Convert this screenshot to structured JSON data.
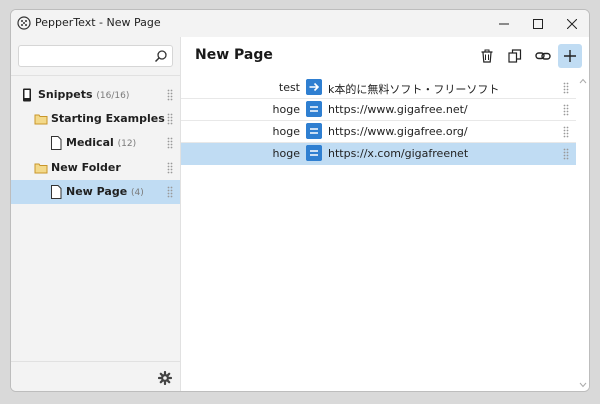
{
  "window": {
    "title": "PepperText - New Page"
  },
  "search": {
    "placeholder": "",
    "value": ""
  },
  "sidebar": {
    "items": [
      {
        "label": "Snippets",
        "count": "(16/16)"
      },
      {
        "label": "Starting Examples",
        "count": ""
      },
      {
        "label": "Medical",
        "count": "(12)"
      },
      {
        "label": "New Folder",
        "count": ""
      },
      {
        "label": "New Page",
        "count": "(4)"
      }
    ]
  },
  "main": {
    "title": "New Page",
    "rows": [
      {
        "key": "test",
        "value": "k本的に無料ソフト・フリーソフト",
        "type": "arrow-icon"
      },
      {
        "key": "hoge",
        "value": "https://www.gigafree.net/",
        "type": "equals-icon"
      },
      {
        "key": "hoge",
        "value": "https://www.gigafree.org/",
        "type": "equals-icon"
      },
      {
        "key": "hoge",
        "value": "https://x.com/gigafreenet",
        "type": "equals-icon"
      }
    ]
  },
  "colors": {
    "accent": "#2f7fd1",
    "selection": "#c0dcf3",
    "folder": "#c8962a"
  }
}
